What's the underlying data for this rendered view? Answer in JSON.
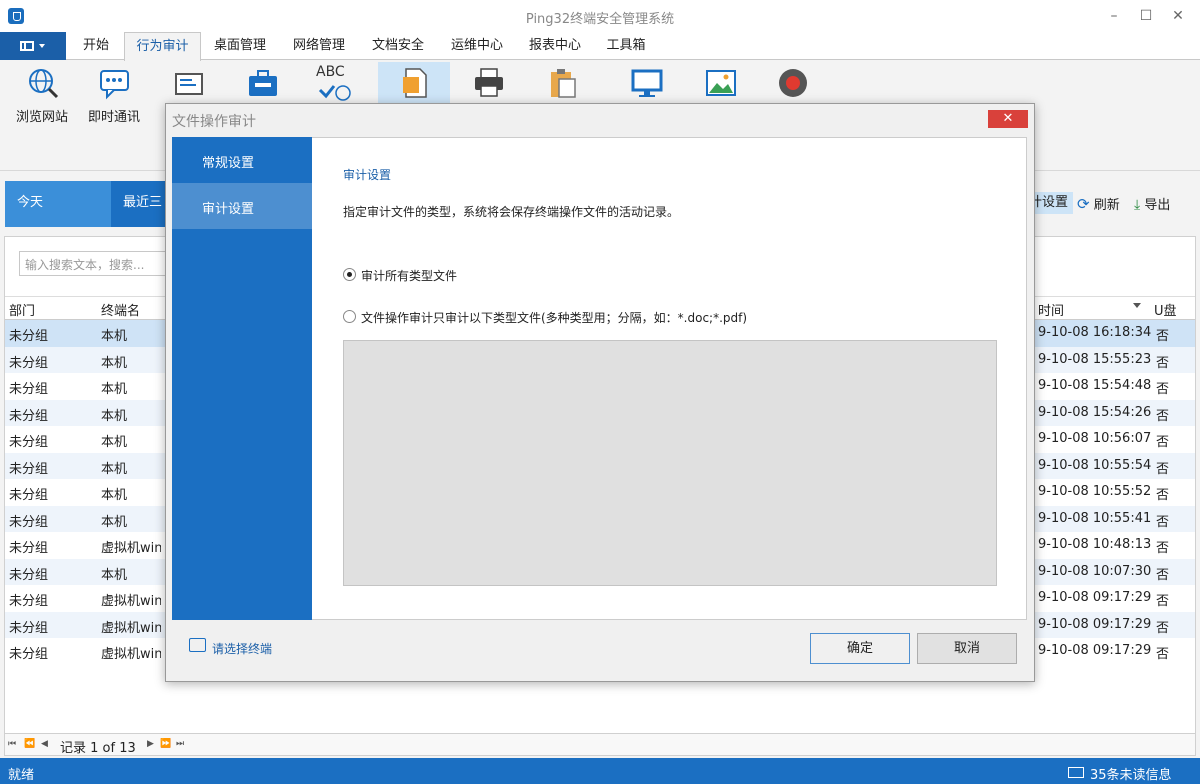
{
  "window": {
    "title": "Ping32终端安全管理系统",
    "minimize": "–",
    "maximize": "☐",
    "close": "✕"
  },
  "menu": {
    "tabs": [
      "开始",
      "行为审计",
      "桌面管理",
      "网络管理",
      "文档安全",
      "运维中心",
      "报表中心",
      "工具箱"
    ],
    "active": "行为审计"
  },
  "toolbar": {
    "items": [
      {
        "label": "浏览网站",
        "icon": "globe-search-icon"
      },
      {
        "label": "即时通讯",
        "icon": "chat-icon"
      },
      {
        "label": "",
        "icon": "email-icon"
      },
      {
        "label": "",
        "icon": "briefcase-icon"
      },
      {
        "label": "ABC",
        "icon": "abc-network-icon"
      },
      {
        "label": "",
        "icon": "file-icon"
      },
      {
        "label": "",
        "icon": "printer-icon"
      },
      {
        "label": "",
        "icon": "clipboard-icon"
      },
      {
        "label": "",
        "icon": "monitor-icon"
      },
      {
        "label": "",
        "icon": "image-icon"
      },
      {
        "label": "",
        "icon": "record-icon"
      }
    ]
  },
  "datetabs": {
    "today": "今天",
    "recent": "最近三"
  },
  "actions": {
    "audit_settings": "计设置",
    "refresh": "刷新",
    "export": "导出"
  },
  "grid": {
    "search_placeholder": "输入搜索文本，搜索...",
    "headers": {
      "dept": "部门",
      "terminal": "终端名",
      "time": "时间",
      "udisk": "U盘"
    },
    "rows": [
      {
        "dept": "未分组",
        "terminal": "本机",
        "time": "9-10-08 16:18:34",
        "udisk": "否"
      },
      {
        "dept": "未分组",
        "terminal": "本机",
        "time": "9-10-08 15:55:23",
        "udisk": "否"
      },
      {
        "dept": "未分组",
        "terminal": "本机",
        "time": "9-10-08 15:54:48",
        "udisk": "否"
      },
      {
        "dept": "未分组",
        "terminal": "本机",
        "time": "9-10-08 15:54:26",
        "udisk": "否"
      },
      {
        "dept": "未分组",
        "terminal": "本机",
        "time": "9-10-08 10:56:07",
        "udisk": "否"
      },
      {
        "dept": "未分组",
        "terminal": "本机",
        "time": "9-10-08 10:55:54",
        "udisk": "否"
      },
      {
        "dept": "未分组",
        "terminal": "本机",
        "time": "9-10-08 10:55:52",
        "udisk": "否"
      },
      {
        "dept": "未分组",
        "terminal": "本机",
        "time": "9-10-08 10:55:41",
        "udisk": "否"
      },
      {
        "dept": "未分组",
        "terminal": "虚拟机win1",
        "time": "9-10-08 10:48:13",
        "udisk": "否"
      },
      {
        "dept": "未分组",
        "terminal": "本机",
        "time": "9-10-08 10:07:30",
        "udisk": "否"
      },
      {
        "dept": "未分组",
        "terminal": "虚拟机win1",
        "time": "9-10-08 09:17:29",
        "udisk": "否"
      },
      {
        "dept": "未分组",
        "terminal": "虚拟机win1",
        "time": "9-10-08 09:17:29",
        "udisk": "否"
      },
      {
        "dept": "未分组",
        "terminal": "虚拟机win1",
        "time": "9-10-08 09:17:29",
        "udisk": "否"
      }
    ],
    "pager": "记录 1 of 13"
  },
  "status": {
    "text": "就绪",
    "unread": "35条未读信息"
  },
  "dialog": {
    "title": "文件操作审计",
    "close": "✕",
    "side": [
      "常规设置",
      "审计设置"
    ],
    "section_title": "审计设置",
    "description": "指定审计文件的类型，系统将会保存终端操作文件的活动记录。",
    "option_all": "审计所有类型文件",
    "option_specific": "文件操作审计只审计以下类型文件(多种类型用；分隔，如：*.doc;*.pdf)",
    "choose_terminal": "请选择终端",
    "ok": "确定",
    "cancel": "取消"
  }
}
